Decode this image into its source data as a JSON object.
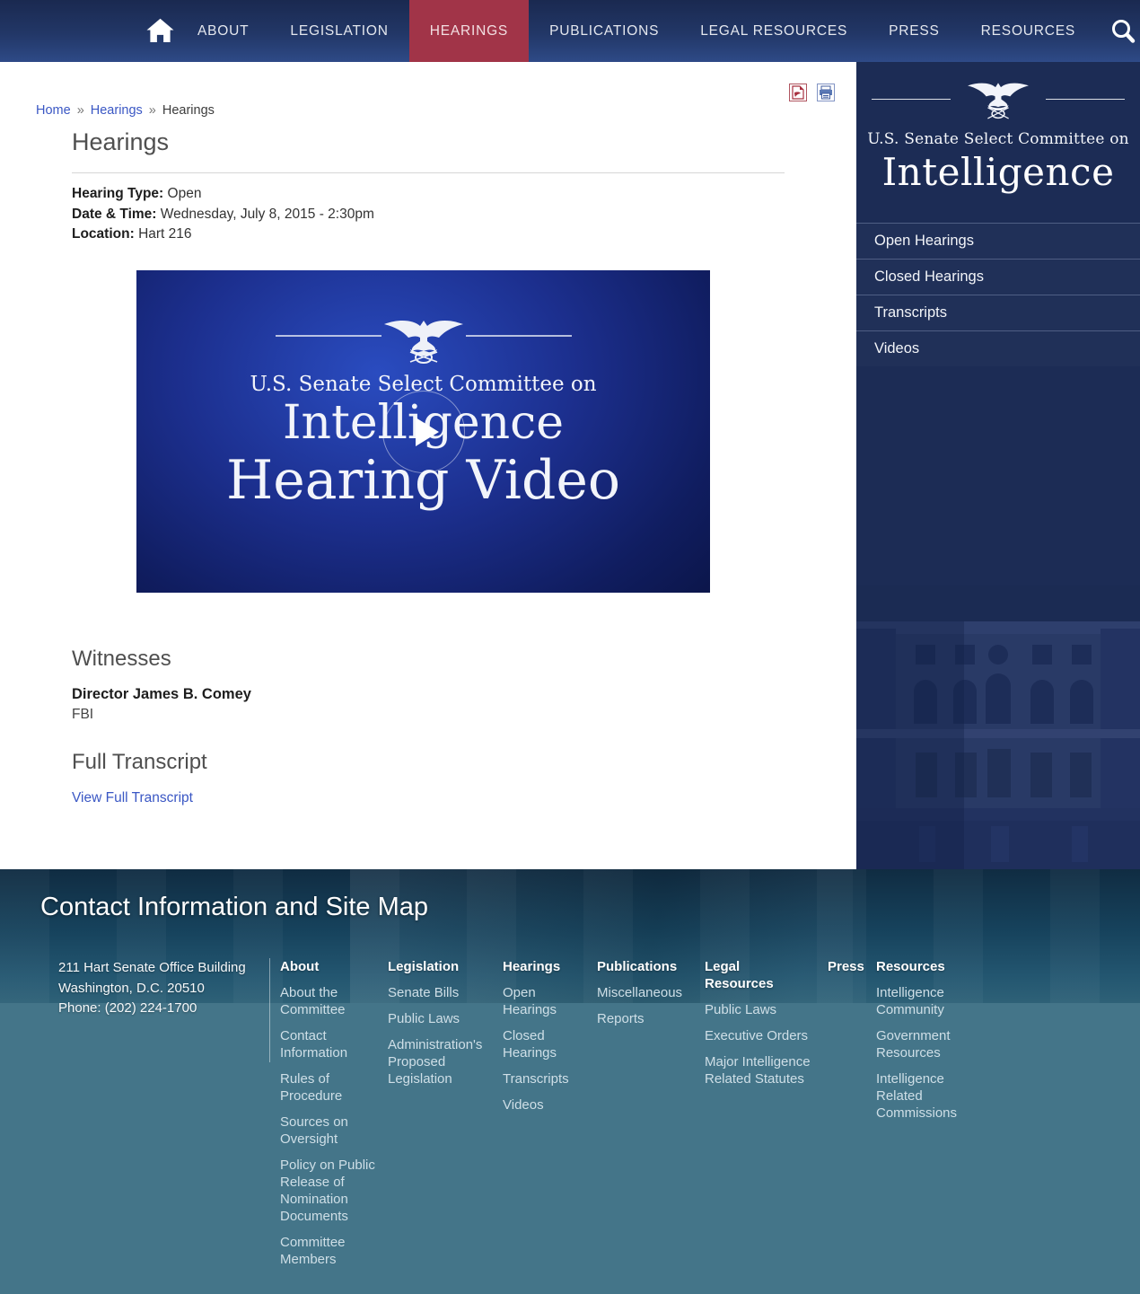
{
  "colors": {
    "accent_red": "#a13448",
    "navy": "#1c2c55",
    "footer_teal": "#447589",
    "link_blue": "#3a57c4"
  },
  "icons": {
    "home": "house",
    "search": "magnifier",
    "pdf": "pdf-document",
    "print": "printer",
    "play": "play-triangle",
    "eagle": "senate-eagle-crest"
  },
  "nav": {
    "items": [
      {
        "label": "ABOUT",
        "active": false
      },
      {
        "label": "LEGISLATION",
        "active": false
      },
      {
        "label": "HEARINGS",
        "active": true
      },
      {
        "label": "PUBLICATIONS",
        "active": false
      },
      {
        "label": "LEGAL RESOURCES",
        "active": false
      },
      {
        "label": "PRESS",
        "active": false
      },
      {
        "label": "RESOURCES",
        "active": false
      }
    ]
  },
  "breadcrumb": {
    "home": "Home",
    "section": "Hearings",
    "current": "Hearings",
    "separator": "»"
  },
  "page": {
    "title": "Hearings",
    "hearing_type_label": "Hearing Type:",
    "hearing_type": "Open",
    "datetime_label": "Date & Time:",
    "datetime": "Wednesday, July 8, 2015 - 2:30pm",
    "location_label": "Location:",
    "location": "Hart 216"
  },
  "video": {
    "brand_line": "U.S. Senate Select Committee on",
    "brand_name": "Intelligence",
    "title": "Hearing Video"
  },
  "witnesses": {
    "heading": "Witnesses",
    "name": "Director James B. Comey",
    "organization": "FBI"
  },
  "transcript": {
    "heading": "Full Transcript",
    "link_label": "View Full Transcript"
  },
  "sidebar": {
    "logo_line1": "U.S. Senate Select Committee on",
    "logo_line2": "Intelligence",
    "items": [
      {
        "label": "Open Hearings"
      },
      {
        "label": "Closed Hearings"
      },
      {
        "label": "Transcripts"
      },
      {
        "label": "Videos"
      }
    ]
  },
  "footer": {
    "heading": "Contact Information and Site Map",
    "contact": {
      "address1": "211 Hart Senate Office Building",
      "address2": "Washington, D.C. 20510",
      "phone": "Phone: (202) 224-1700"
    },
    "columns": [
      {
        "title": "About",
        "links": [
          "About the Committee",
          "Contact Information",
          "Rules of Procedure",
          "Sources on Oversight",
          "Policy on Public Release of Nomination Documents",
          "Committee Members"
        ]
      },
      {
        "title": "Legislation",
        "links": [
          "Senate Bills",
          "Public Laws",
          "Administration's Proposed Legislation"
        ]
      },
      {
        "title": "Hearings",
        "links": [
          "Open Hearings",
          "Closed Hearings",
          "Transcripts",
          "Videos"
        ]
      },
      {
        "title": "Publications",
        "links": [
          "Miscellaneous",
          "Reports"
        ]
      },
      {
        "title": "Legal Resources",
        "links": [
          "Public Laws",
          "Executive Orders",
          "Major Intelligence Related Statutes"
        ]
      },
      {
        "title": "Press",
        "links": []
      },
      {
        "title": "Resources",
        "links": [
          "Intelligence Community",
          "Government Resources",
          "Intelligence Related Commissions"
        ]
      }
    ]
  }
}
